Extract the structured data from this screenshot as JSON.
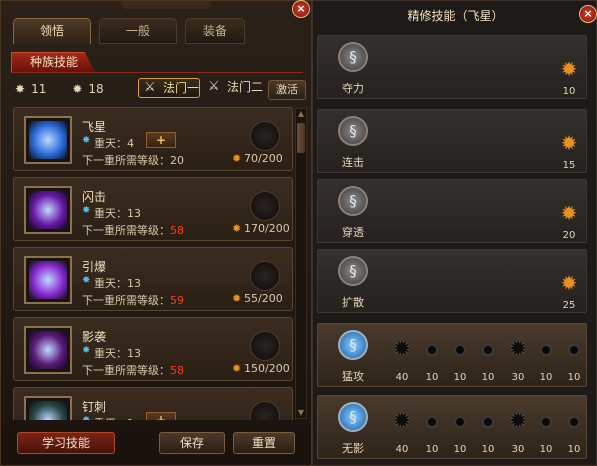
{
  "left": {
    "close": "×",
    "tabs": [
      "领悟",
      "一般",
      "装备"
    ],
    "race_title": "种族技能",
    "resources": {
      "star_count": "11",
      "sun_count": "18"
    },
    "schools": [
      "法门一",
      "法门二"
    ],
    "activate": "激活",
    "skills": [
      {
        "name": "飞星",
        "layer": "重天：4",
        "req_prefix": "下一重所需等级：",
        "req_level": "20",
        "req_ok": true,
        "cost": "70/200",
        "has_plus": true,
        "icon_color": "#2a6ad8"
      },
      {
        "name": "闪击",
        "layer": "重天：13",
        "req_prefix": "下一重所需等级：",
        "req_level": "58",
        "req_ok": false,
        "cost": "170/200",
        "has_plus": false,
        "icon_color": "#6a1aa8"
      },
      {
        "name": "引爆",
        "layer": "重天：13",
        "req_prefix": "下一重所需等级：",
        "req_level": "59",
        "req_ok": false,
        "cost": "55/200",
        "has_plus": false,
        "icon_color": "#8a2ad0"
      },
      {
        "name": "影袭",
        "layer": "重天：13",
        "req_prefix": "下一重所需等级：",
        "req_level": "58",
        "req_ok": false,
        "cost": "150/200",
        "has_plus": false,
        "icon_color": "#5a1a78"
      },
      {
        "name": "钉刺",
        "layer": "重天：1",
        "req_prefix": "",
        "req_level": "",
        "req_ok": true,
        "cost": "",
        "has_plus": true,
        "icon_color": "#2a4a4a"
      }
    ],
    "buttons": {
      "learn": "学习技能",
      "save": "保存",
      "reset": "重置"
    }
  },
  "right": {
    "title": "精修技能（飞星）",
    "close": "×",
    "rows": [
      {
        "label": "夺力",
        "value": "10",
        "style": "grey"
      },
      {
        "label": "连击",
        "value": "15",
        "style": "grey"
      },
      {
        "label": "穿透",
        "value": "20",
        "style": "grey"
      },
      {
        "label": "扩散",
        "value": "25",
        "style": "grey"
      },
      {
        "label": "猛攻",
        "style": "brown",
        "nodes": [
          "40",
          "10",
          "10",
          "10",
          "30",
          "10",
          "10"
        ]
      },
      {
        "label": "无影",
        "style": "brown",
        "nodes": [
          "40",
          "10",
          "10",
          "10",
          "30",
          "10",
          "10"
        ]
      }
    ]
  },
  "icons": {
    "star": "star-icon",
    "sun": "sun-icon",
    "sword": "sword-icon",
    "swirl": "swirl-icon"
  },
  "colors": {
    "accent_red": "#a02a18",
    "warn_red": "#ff3a1a",
    "gold": "#e89020",
    "blue": "#58b8e8"
  }
}
